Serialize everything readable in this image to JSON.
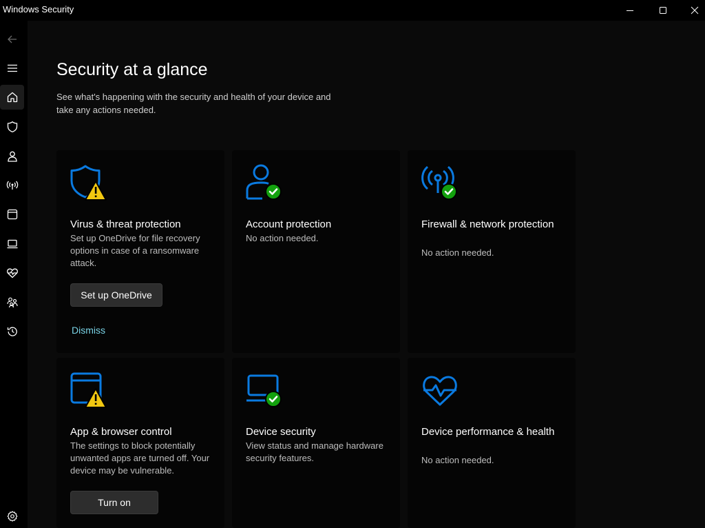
{
  "window": {
    "title": "Windows Security"
  },
  "sidebar": {
    "items": [
      {
        "name": "back",
        "icon": "back-arrow-icon"
      },
      {
        "name": "menu",
        "icon": "hamburger-menu-icon"
      },
      {
        "name": "home",
        "icon": "home-icon",
        "selected": true
      },
      {
        "name": "virus-threat",
        "icon": "shield-icon"
      },
      {
        "name": "account",
        "icon": "person-icon"
      },
      {
        "name": "firewall",
        "icon": "antenna-icon"
      },
      {
        "name": "app-browser",
        "icon": "browser-window-icon"
      },
      {
        "name": "device-security",
        "icon": "laptop-icon"
      },
      {
        "name": "device-performance",
        "icon": "heart-pulse-icon"
      },
      {
        "name": "family",
        "icon": "family-icon"
      },
      {
        "name": "history",
        "icon": "history-icon"
      },
      {
        "name": "settings",
        "icon": "gear-icon"
      }
    ]
  },
  "main": {
    "title": "Security at a glance",
    "description": "See what's happening with the security and health of your device and take any actions needed."
  },
  "colors": {
    "accent_blue": "#0a7ae0",
    "warning_yellow": "#f2c811",
    "ok_green": "#13a10e",
    "link": "#7ad3e6"
  },
  "cards": [
    {
      "icon": "shield-warning-icon",
      "title": "Virus & threat protection",
      "description": "Set up OneDrive for file recovery options in case of a ransomware attack.",
      "button": "Set up OneDrive",
      "link": "Dismiss"
    },
    {
      "icon": "account-check-icon",
      "title": "Account protection",
      "description": "No action needed."
    },
    {
      "icon": "antenna-check-icon",
      "title": "Firewall & network protection",
      "description": "No action needed."
    },
    {
      "icon": "browser-warning-icon",
      "title": "App & browser control",
      "description": "The settings to block potentially unwanted apps are turned off. Your device may be vulnerable.",
      "button": "Turn on"
    },
    {
      "icon": "laptop-check-icon",
      "title": "Device security",
      "description": "View status and manage hardware security features."
    },
    {
      "icon": "heart-pulse-icon",
      "title": "Device performance & health",
      "description": "No action needed."
    }
  ]
}
